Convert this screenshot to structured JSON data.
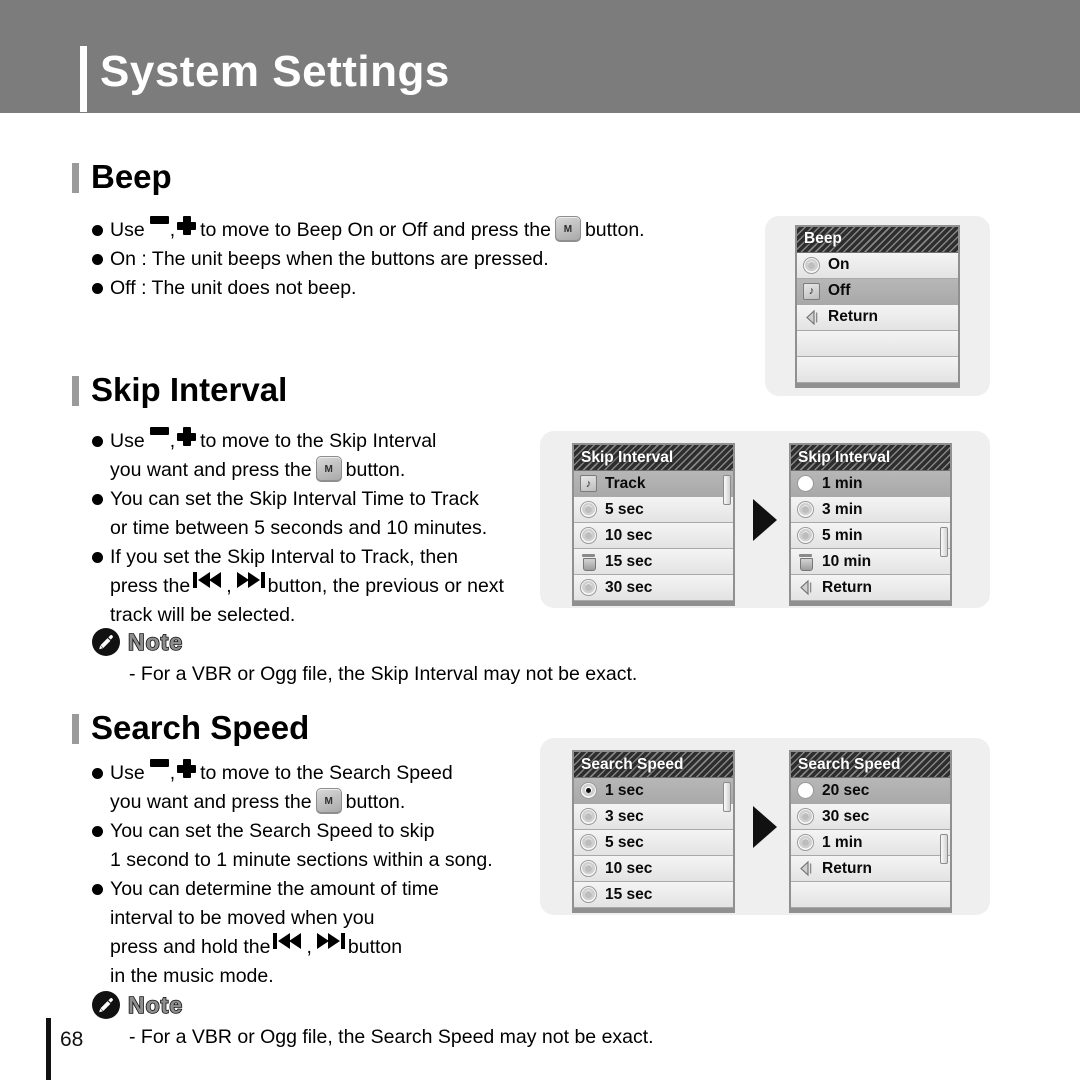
{
  "header": {
    "title": "System Settings"
  },
  "sections": {
    "beep": {
      "heading": "Beep",
      "lines": {
        "l1a": "Use",
        "l1b": "to move to Beep On or Off and press the",
        "l1c": "button.",
        "l2": "On : The unit beeps when the buttons are pressed.",
        "l3": "Off : The unit does not beep."
      }
    },
    "skip_interval": {
      "heading": "Skip Interval",
      "lines": {
        "l1a": "Use",
        "l1b": "to move to the Skip Interval",
        "l1c": "you want and press the",
        "l1d": "button.",
        "l2a": "You can set the Skip Interval Time to Track",
        "l2b": "or time between 5 seconds and 10 minutes.",
        "l3a": "If you set the Skip Interval to Track, then",
        "l3b": "press the",
        "l3c": "button, the previous or next",
        "l3d": "track will be selected."
      },
      "note": {
        "label": "Note",
        "text": "- For a VBR or Ogg file, the Skip Interval may not be exact."
      }
    },
    "search_speed": {
      "heading": "Search Speed",
      "lines": {
        "l1a": "Use",
        "l1b": "to move to the Search Speed",
        "l1c": "you want and press the",
        "l1d": "button.",
        "l2a": "You can set the Search Speed to skip",
        "l2b": "1 second to 1 minute sections within a song.",
        "l3a": "You can determine the amount of time",
        "l3b": "interval to be moved when you",
        "l3c": "press and hold the",
        "l3d": "button",
        "l3e": "in the music mode."
      },
      "note": {
        "label": "Note",
        "text": "- For a VBR or Ogg file, the Search Speed may not be exact."
      }
    }
  },
  "screens": {
    "beep": {
      "title": "Beep",
      "rows": [
        {
          "icon": "radio-icon",
          "label": "On",
          "selected": false
        },
        {
          "icon": "music-note-icon",
          "label": "Off",
          "selected": true
        },
        {
          "icon": "return-icon",
          "label": "Return",
          "selected": false
        },
        {
          "icon": "none",
          "label": "",
          "selected": false
        },
        {
          "icon": "none",
          "label": "",
          "selected": false
        }
      ]
    },
    "skip_interval_1": {
      "title": "Skip Interval",
      "rows": [
        {
          "icon": "music-note-icon",
          "label": "Track",
          "selected": true
        },
        {
          "icon": "radio-icon",
          "label": "5 sec",
          "selected": false
        },
        {
          "icon": "radio-icon",
          "label": "10 sec",
          "selected": false
        },
        {
          "icon": "trash-icon",
          "label": "15 sec",
          "selected": false
        },
        {
          "icon": "radio-icon",
          "label": "30 sec",
          "selected": false
        }
      ]
    },
    "skip_interval_2": {
      "title": "Skip Interval",
      "rows": [
        {
          "icon": "radio-hollow-icon",
          "label": "1 min",
          "selected": true
        },
        {
          "icon": "radio-icon",
          "label": "3 min",
          "selected": false
        },
        {
          "icon": "radio-icon",
          "label": "5 min",
          "selected": false
        },
        {
          "icon": "trash-icon",
          "label": "10 min",
          "selected": false
        },
        {
          "icon": "return-icon",
          "label": "Return",
          "selected": false
        }
      ]
    },
    "search_speed_1": {
      "title": "Search Speed",
      "rows": [
        {
          "icon": "radio-on-icon",
          "label": "1 sec",
          "selected": true
        },
        {
          "icon": "radio-icon",
          "label": "3 sec",
          "selected": false
        },
        {
          "icon": "radio-icon",
          "label": "5 sec",
          "selected": false
        },
        {
          "icon": "radio-icon",
          "label": "10 sec",
          "selected": false
        },
        {
          "icon": "radio-icon",
          "label": "15 sec",
          "selected": false
        }
      ]
    },
    "search_speed_2": {
      "title": "Search Speed",
      "rows": [
        {
          "icon": "radio-hollow-icon",
          "label": "20 sec",
          "selected": true
        },
        {
          "icon": "radio-icon",
          "label": "30 sec",
          "selected": false
        },
        {
          "icon": "radio-icon",
          "label": "1 min",
          "selected": false
        },
        {
          "icon": "return-icon",
          "label": "Return",
          "selected": false
        },
        {
          "icon": "none",
          "label": "",
          "selected": false
        }
      ]
    }
  },
  "footer": {
    "page_number": "68"
  },
  "colors": {
    "header_band": "#7c7c7c",
    "heading_bar": "#9a9a9a",
    "panel_bg": "#efefef",
    "lcd_title_bg": "#2e2e2e",
    "lcd_row_bg": "#ebebeb",
    "lcd_row_selected_bg": "#b0b0b0"
  }
}
